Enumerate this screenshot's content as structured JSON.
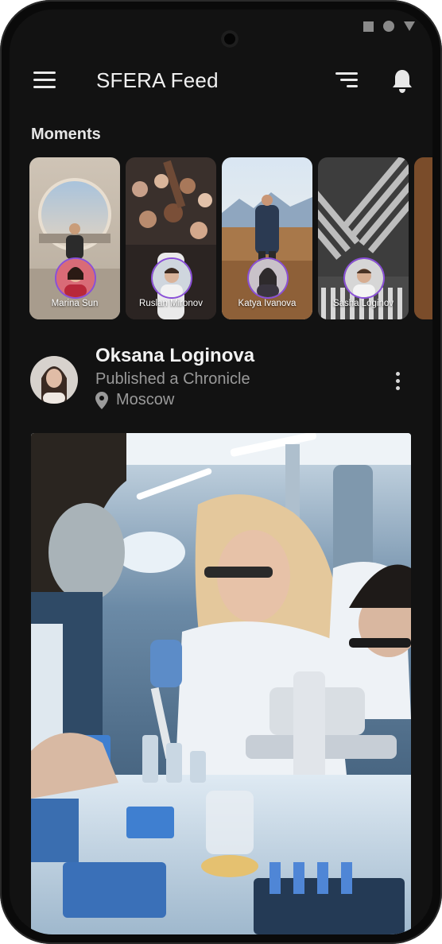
{
  "app": {
    "title": "SFERA Feed",
    "icons": {
      "menu": "menu-icon",
      "filter": "filter-icon",
      "notifications": "bell-icon"
    }
  },
  "moments": {
    "title": "Moments",
    "items": [
      {
        "name": "Marina Sun"
      },
      {
        "name": "Ruslan Mironov"
      },
      {
        "name": "Katya Ivanova"
      },
      {
        "name": "Sasha Loginov"
      }
    ],
    "ring_color": "#8a4fd8"
  },
  "post": {
    "author": "Oksana Loginova",
    "action": "Published a Chronicle",
    "location": "Moscow",
    "icons": {
      "location": "location-pin-icon",
      "more": "more-vertical-icon"
    }
  },
  "colors": {
    "background": "#121212",
    "text_primary": "#f2f2f2",
    "text_secondary": "#9a9a9a"
  }
}
